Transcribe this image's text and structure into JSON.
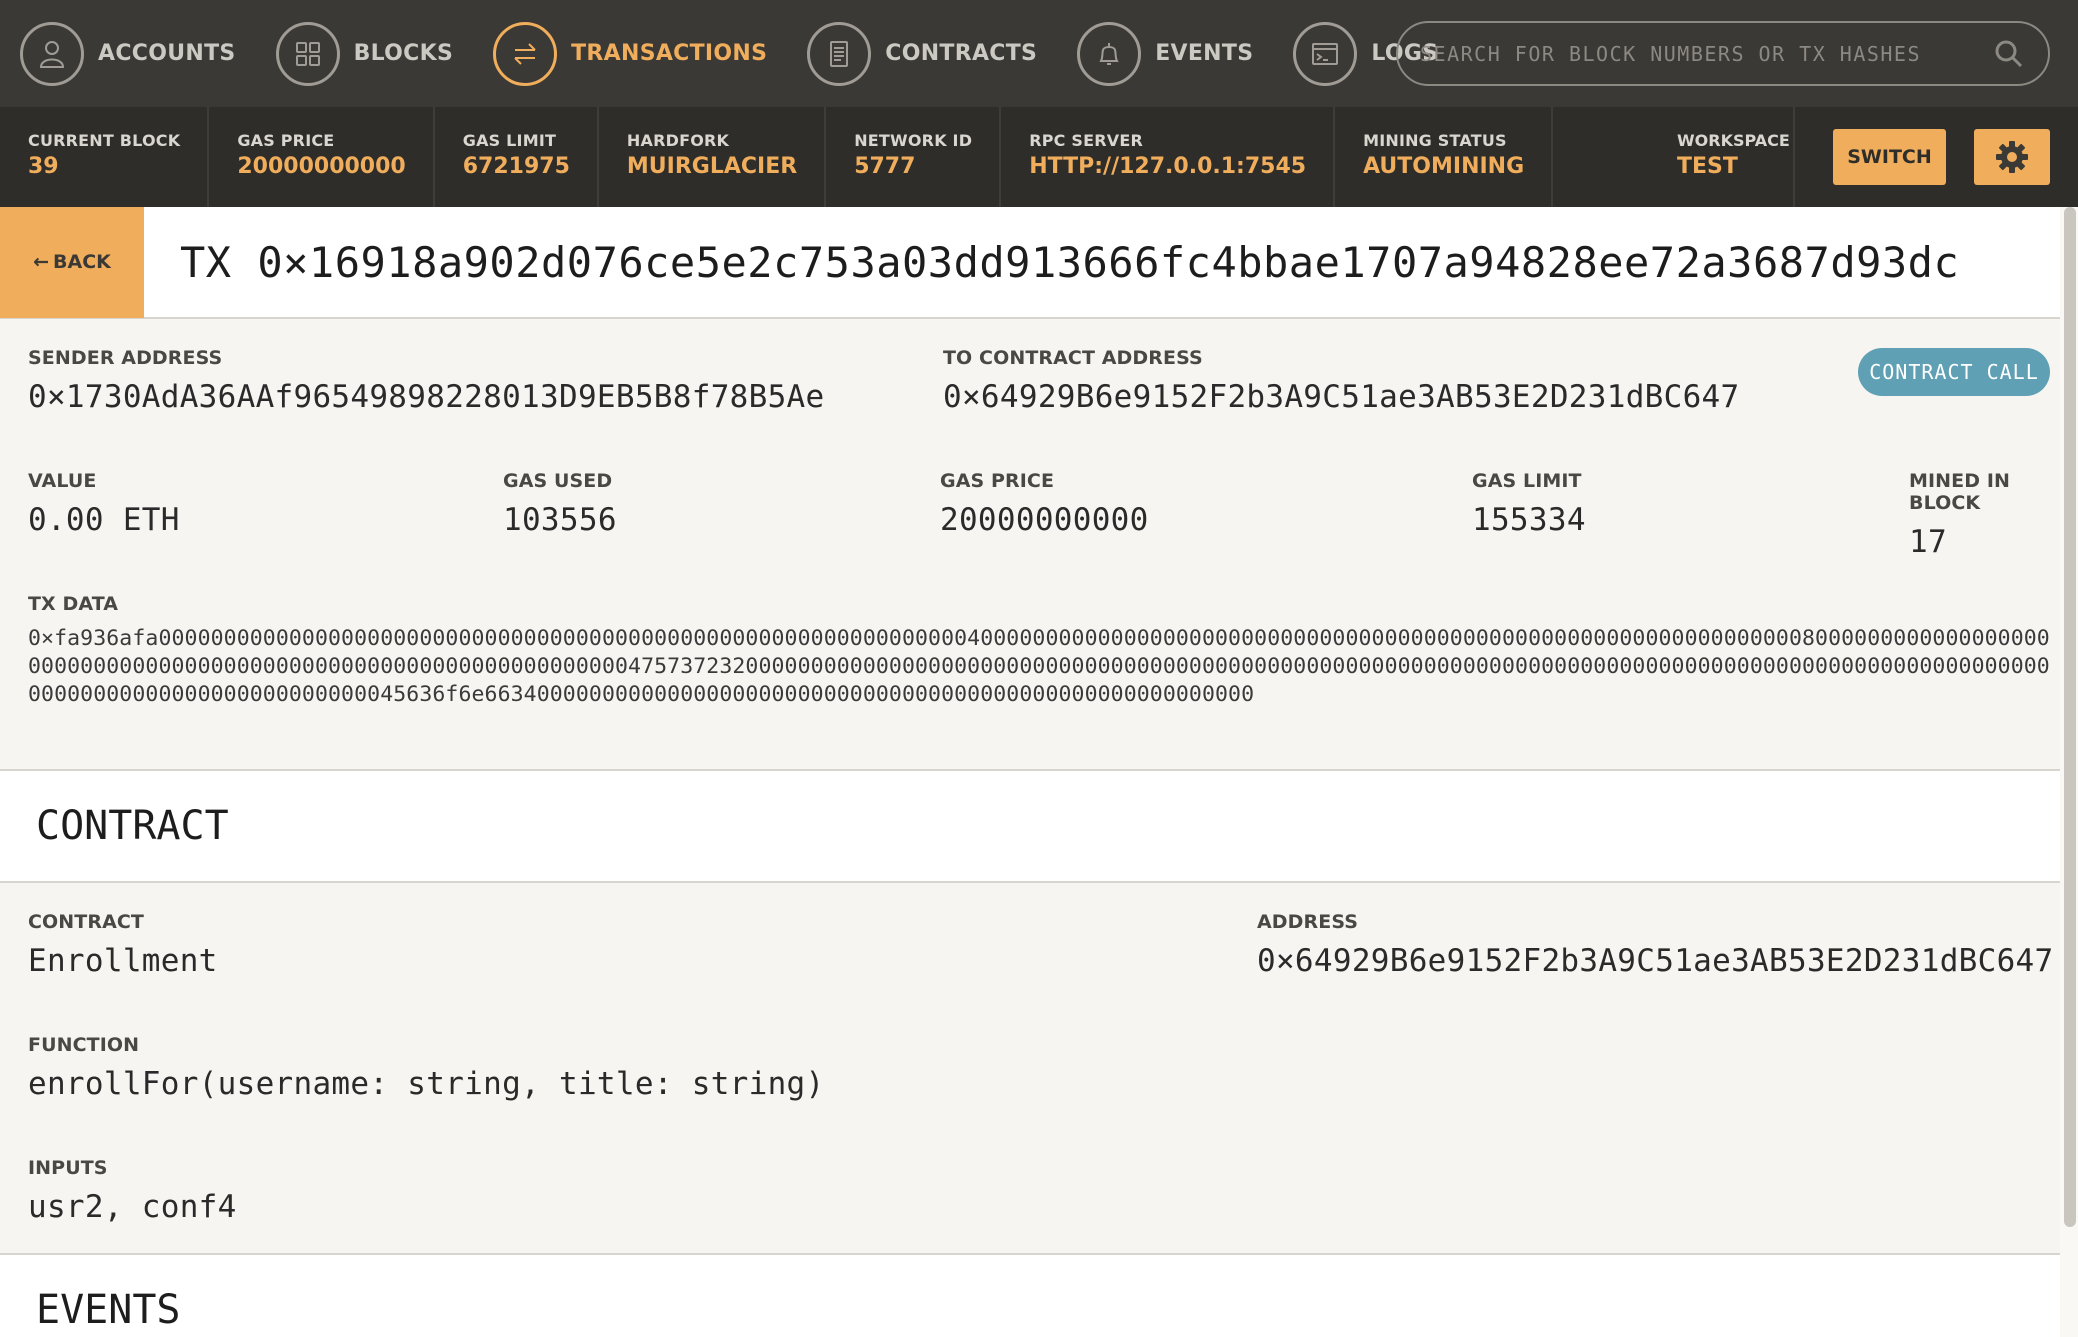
{
  "nav": {
    "items": [
      {
        "label": "ACCOUNTS",
        "icon": "user-icon",
        "active": false
      },
      {
        "label": "BLOCKS",
        "icon": "grid-icon",
        "active": false
      },
      {
        "label": "TRANSACTIONS",
        "icon": "swap-arrows-icon",
        "active": true
      },
      {
        "label": "CONTRACTS",
        "icon": "document-icon",
        "active": false
      },
      {
        "label": "EVENTS",
        "icon": "bell-icon",
        "active": false
      },
      {
        "label": "LOGS",
        "icon": "terminal-icon",
        "active": false
      }
    ],
    "search_placeholder": "SEARCH FOR BLOCK NUMBERS OR TX HASHES"
  },
  "status": {
    "current_block": {
      "label": "CURRENT BLOCK",
      "value": "39"
    },
    "gas_price": {
      "label": "GAS PRICE",
      "value": "20000000000"
    },
    "gas_limit": {
      "label": "GAS LIMIT",
      "value": "6721975"
    },
    "hardfork": {
      "label": "HARDFORK",
      "value": "MUIRGLACIER"
    },
    "network_id": {
      "label": "NETWORK ID",
      "value": "5777"
    },
    "rpc_server": {
      "label": "RPC SERVER",
      "value": "HTTP://127.0.0.1:7545"
    },
    "mining_status": {
      "label": "MINING STATUS",
      "value": "AUTOMINING"
    },
    "workspace": {
      "label": "WORKSPACE",
      "value": "TEST"
    },
    "switch_label": "SWITCH"
  },
  "tx": {
    "back_label": "BACK",
    "title": "TX 0×16918a902d076ce5e2c753a03dd913666fc4bbae1707a94828ee72a3687d93dc",
    "sender": {
      "label": "SENDER ADDRESS",
      "value": "0×1730AdA36AAf96549898228013D9EB5B8f78B5Ae"
    },
    "to": {
      "label": "TO CONTRACT ADDRESS",
      "value": "0×64929B6e9152F2b3A9C51ae3AB53E2D231dBC647"
    },
    "badge": "CONTRACT CALL",
    "value": {
      "label": "VALUE",
      "value": "0.00 ETH"
    },
    "gas_used": {
      "label": "GAS USED",
      "value": "103556"
    },
    "gas_price": {
      "label": "GAS PRICE",
      "value": "20000000000"
    },
    "gas_limit": {
      "label": "GAS LIMIT",
      "value": "155334"
    },
    "mined_in_block": {
      "label": "MINED IN BLOCK",
      "value": "17"
    },
    "tx_data": {
      "label": "TX DATA",
      "value": "0×fa936afa00000000000000000000000000000000000000000000000000000000000000400000000000000000000000000000000000000000000000000000000000000080000000000000000000000000000000000000000000000000000000000000000475737232000000000000000000000000000000000000000000000000000000000000000000000000000000000000000000000000000000000000000000000000000000045636f6e66340000000000000000000000000000000000000000000000000000000"
    }
  },
  "contract": {
    "title": "CONTRACT",
    "name": {
      "label": "CONTRACT",
      "value": "Enrollment"
    },
    "address": {
      "label": "ADDRESS",
      "value": "0×64929B6e9152F2b3A9C51ae3AB53E2D231dBC647"
    },
    "function": {
      "label": "FUNCTION",
      "value": "enrollFor(username: string, title: string)"
    },
    "inputs": {
      "label": "INPUTS",
      "value": "usr2, conf4"
    }
  },
  "events": {
    "title": "EVENTS"
  },
  "colors": {
    "accent": "#f0ad5c",
    "nav_bg": "#3b3935",
    "status_bg": "#2f2d2a",
    "badge": "#5fa0b5"
  }
}
